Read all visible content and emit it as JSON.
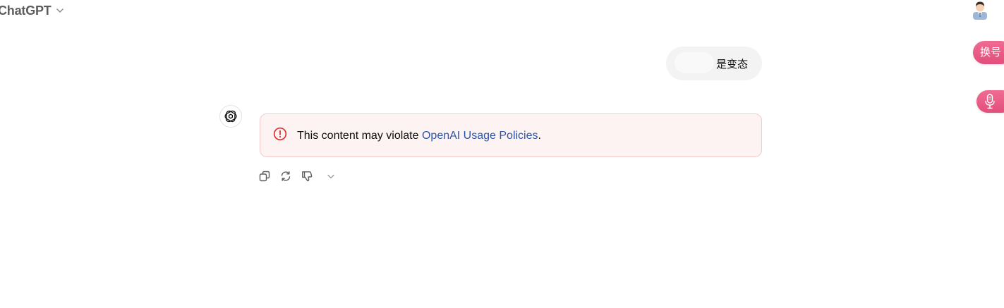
{
  "header": {
    "model_name": "ChatGPT",
    "chevron_icon": "chevron-down-icon"
  },
  "widgets": {
    "avatar_icon": "user-avatar-icon",
    "switch_account_label": "换号",
    "mic_icon": "microphone-icon",
    "accent_color": "#e8557f"
  },
  "conversation": {
    "user_message": "是变态",
    "assistant_icon": "openai-logo-icon",
    "alert": {
      "icon": "info-circle-icon",
      "text_prefix": "This content may violate ",
      "link_text": "OpenAI Usage Policies",
      "text_suffix": ".",
      "border_color": "#f5c9c9",
      "background_color": "#fdf3f3",
      "icon_color": "#e0332e",
      "link_color": "#2d56a8"
    },
    "actions": [
      {
        "name": "copy",
        "icon": "copy-icon"
      },
      {
        "name": "regenerate",
        "icon": "refresh-icon"
      },
      {
        "name": "bad-response",
        "icon": "thumbs-down-icon"
      },
      {
        "name": "more",
        "icon": "chevron-down-icon"
      }
    ]
  }
}
